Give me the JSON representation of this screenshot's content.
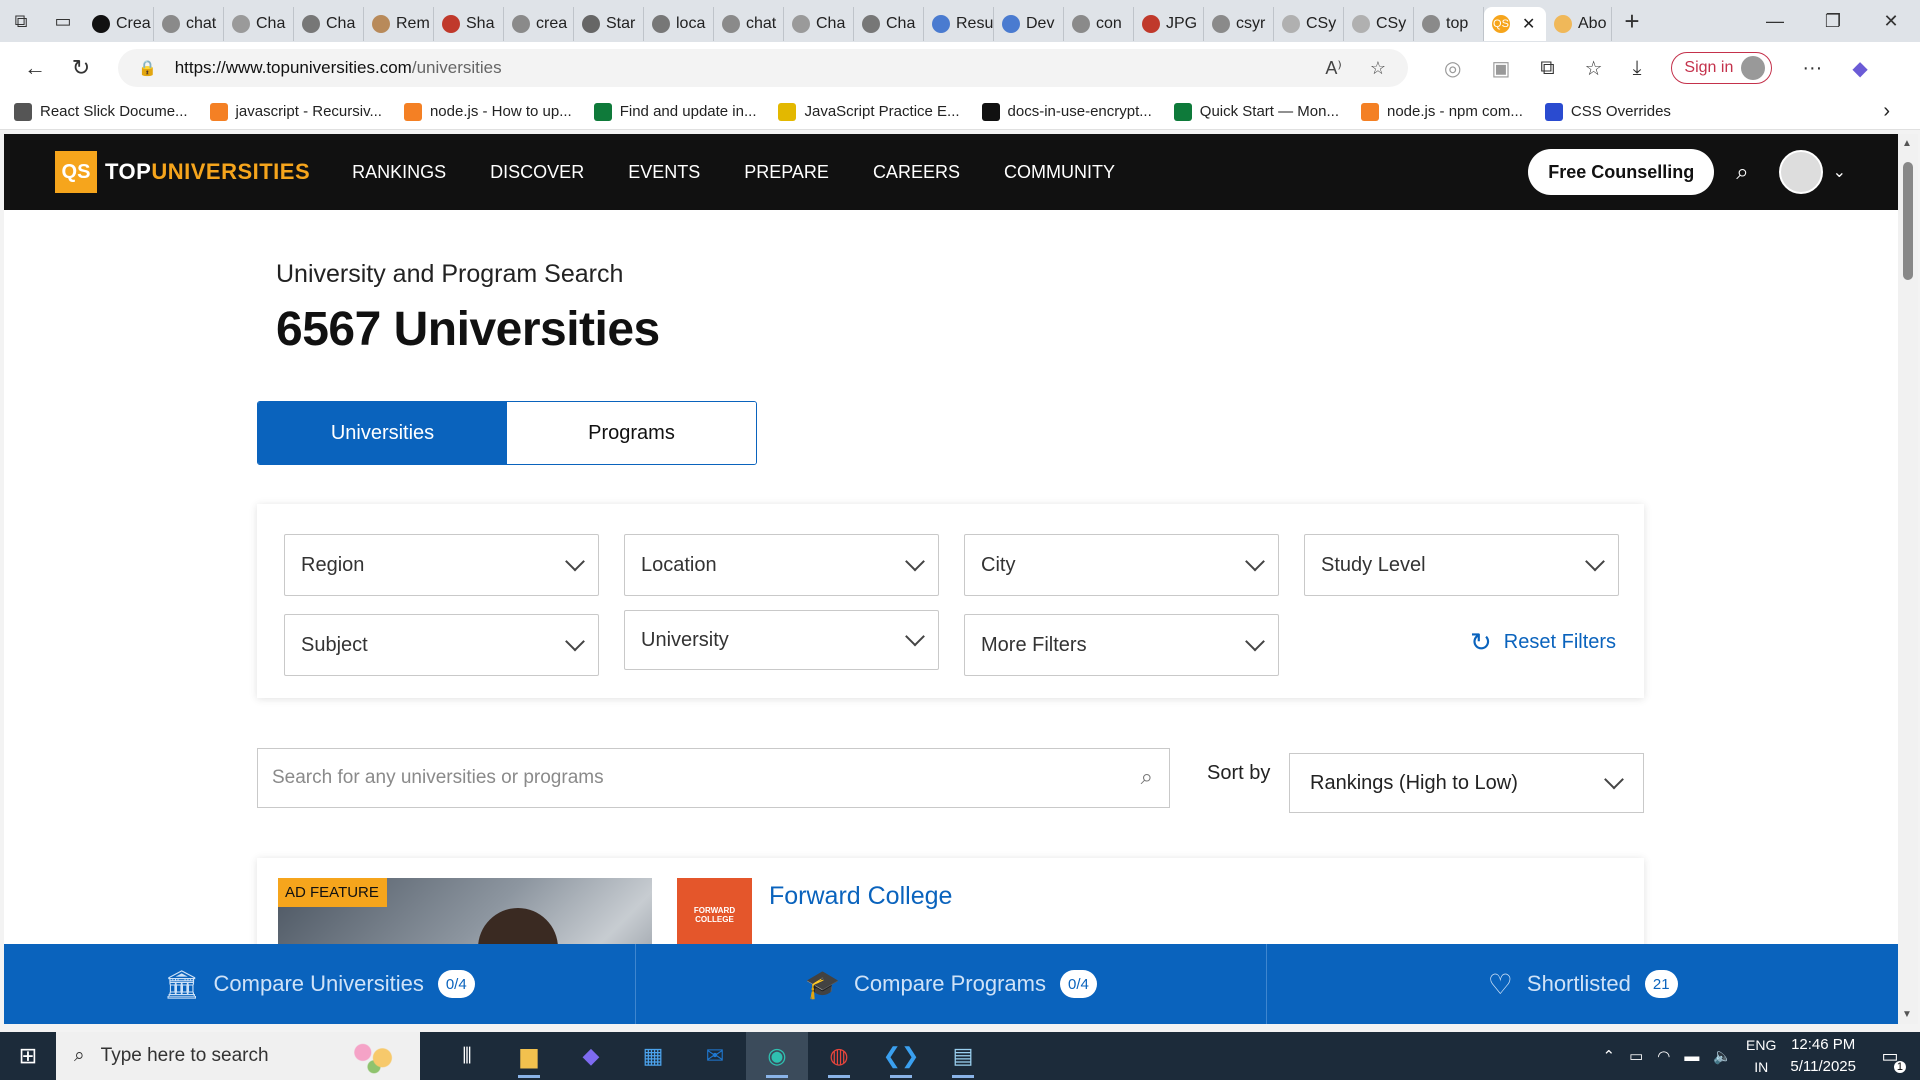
{
  "browser": {
    "tabs": [
      {
        "label": "Crea",
        "icon": "openai-icon",
        "color": "#111111"
      },
      {
        "label": "chat",
        "icon": "search-icon",
        "color": "#8a8a8a"
      },
      {
        "label": "Cha",
        "icon": "chat-icon",
        "color": "#9a9a9a"
      },
      {
        "label": "Cha",
        "icon": "chat-icon",
        "color": "#777777"
      },
      {
        "label": "Rem",
        "icon": "remote-icon",
        "color": "#b88a5a"
      },
      {
        "label": "Sha",
        "icon": "share-icon",
        "color": "#c0392b"
      },
      {
        "label": "crea",
        "icon": "search-icon",
        "color": "#8a8a8a"
      },
      {
        "label": "Star",
        "icon": "star-icon",
        "color": "#666666"
      },
      {
        "label": "loca",
        "icon": "file-icon",
        "color": "#777777"
      },
      {
        "label": "chat",
        "icon": "search-icon",
        "color": "#8a8a8a"
      },
      {
        "label": "Cha",
        "icon": "chat-icon",
        "color": "#9a9a9a"
      },
      {
        "label": "Cha",
        "icon": "chat-icon",
        "color": "#777777"
      },
      {
        "label": "Resu",
        "icon": "star-icon",
        "color": "#4a7bd0"
      },
      {
        "label": "Dev",
        "icon": "star-icon",
        "color": "#4a7bd0"
      },
      {
        "label": "con",
        "icon": "search-icon",
        "color": "#8a8a8a"
      },
      {
        "label": "JPG",
        "icon": "image-icon",
        "color": "#c0392b"
      },
      {
        "label": "csyr",
        "icon": "search-icon",
        "color": "#8a8a8a"
      },
      {
        "label": "CSy",
        "icon": "csy-icon",
        "color": "#b0b0b0"
      },
      {
        "label": "CSy",
        "icon": "csy-icon",
        "color": "#b0b0b0"
      },
      {
        "label": "top",
        "icon": "search-icon",
        "color": "#8a8a8a"
      }
    ],
    "active_tab": {
      "label": "QS",
      "icon": "qs-icon",
      "color": "#f6a51c"
    },
    "after_tab": {
      "label": "Abo",
      "icon": "qs-icon",
      "color": "#f6a51c"
    },
    "new_tab_label": "+",
    "url_host": "https://www.topuniversities.com",
    "url_path": "/universities",
    "sign_in_label": "Sign in",
    "bookmarks": [
      {
        "label": "React Slick Docume...",
        "icon": "globe-icon",
        "color": "#555555"
      },
      {
        "label": "javascript - Recursiv...",
        "icon": "stackoverflow-icon",
        "color": "#f48024"
      },
      {
        "label": "node.js - How to up...",
        "icon": "stackoverflow-icon",
        "color": "#f48024"
      },
      {
        "label": "Find and update in...",
        "icon": "tf-icon",
        "color": "#0f7a3a"
      },
      {
        "label": "JavaScript Practice E...",
        "icon": "w3-icon",
        "color": "#e3b800"
      },
      {
        "label": "docs-in-use-encrypt...",
        "icon": "github-icon",
        "color": "#111111"
      },
      {
        "label": "Quick Start — Mon...",
        "icon": "mongodb-icon",
        "color": "#0e7a3a"
      },
      {
        "label": "node.js - npm com...",
        "icon": "stackoverflow-icon",
        "color": "#f48024"
      },
      {
        "label": "CSS Overrides",
        "icon": "devtools-icon",
        "color": "#2a4bd0"
      }
    ]
  },
  "site": {
    "logo_mark": "QS",
    "logo_top": "TOP",
    "logo_rest": "UNIVERSITIES",
    "menu": [
      "RANKINGS",
      "DISCOVER",
      "EVENTS",
      "PREPARE",
      "CAREERS",
      "COMMUNITY"
    ],
    "free_counselling": "Free Counselling"
  },
  "main": {
    "subtitle": "University and Program Search",
    "count_title": "6567 Universities",
    "toggle": {
      "universities": "Universities",
      "programs": "Programs"
    },
    "filters": {
      "region": "Region",
      "location": "Location",
      "city": "City",
      "study_level": "Study Level",
      "subject": "Subject",
      "university": "University",
      "more_filters": "More Filters",
      "reset": "Reset Filters"
    },
    "search_placeholder": "Search for any universities or programs",
    "sort_label": "Sort by",
    "sort_value": "Rankings (High to Low)",
    "card": {
      "ad_tag": "AD FEATURE",
      "logo_text": "FORWARD COLLEGE",
      "name": "Forward College"
    },
    "compare": {
      "universities_label": "Compare Universities",
      "universities_count": "0/4",
      "programs_label": "Compare Programs",
      "programs_count": "0/4",
      "shortlisted_label": "Shortlisted",
      "shortlisted_count": "21"
    }
  },
  "taskbar": {
    "search_placeholder": "Type here to search",
    "lang1": "ENG",
    "lang2": "IN",
    "time": "12:46 PM",
    "date": "5/11/2025",
    "notif_count": "1"
  },
  "colors": {
    "brand_blue": "#0a63bd",
    "qs_orange": "#f6a51c",
    "nav_black": "#111111"
  }
}
